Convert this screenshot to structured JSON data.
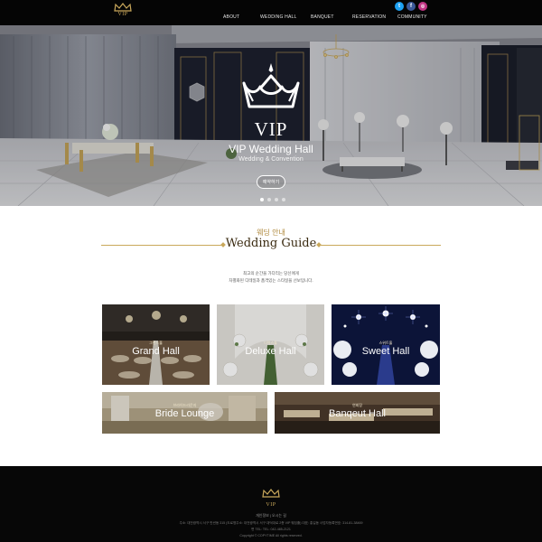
{
  "header": {
    "logo_text": "VIP",
    "nav": [
      "ABOUT",
      "WEDDING HALL",
      "BANQUET",
      "RESERVATION",
      "COMMUNITY"
    ],
    "social": [
      {
        "icon": "twitter-icon",
        "color": "#1da1f2",
        "glyph": "t"
      },
      {
        "icon": "facebook-icon",
        "color": "#3b5998",
        "glyph": "f"
      },
      {
        "icon": "instagram-icon",
        "color": "#c13584",
        "glyph": "◎"
      }
    ]
  },
  "hero": {
    "logo_text": "VIP",
    "title": "VIP Wedding Hall",
    "subtitle": "Wedding & Convention",
    "button": "예약하기",
    "slides": 4,
    "active_slide": 1
  },
  "guide": {
    "label_ko": "웨딩 안내",
    "title": "Wedding Guide",
    "desc_1": "최고의 순간을 가다리는 당신에게",
    "desc_2": "차별화된 디테일과 품격있는 스타일을 선보입니다.",
    "halls": [
      {
        "ko": "그랜드홀",
        "en": "Grand Hall"
      },
      {
        "ko": "디럭스홀",
        "en": "Deluxe Hall"
      },
      {
        "ko": "스위트홀",
        "en": "Sweet Hall"
      },
      {
        "ko": "브라이드라운지",
        "en": "Bride Lounge"
      },
      {
        "ko": "연회장",
        "en": "Banqeut Hall"
      }
    ]
  },
  "footer": {
    "logo_text": "VIP",
    "links": "개인정보  |  오시는 길",
    "address": "주소: 대전광역시 서구 만년동 315 (도로명주소: 대전광역시 서구 대덕대로 2층 VIP 웨딩홀) 대표: 홍길동 사업자등록번호: 314-81-38469",
    "tel": "면 TEL: TEL: 042-485-2121",
    "copyright": "Copyright © COPYTIME All rights reserved."
  },
  "colors": {
    "gold": "#c9a85b",
    "header_bg": "#050505",
    "footer_bg": "#070707"
  }
}
